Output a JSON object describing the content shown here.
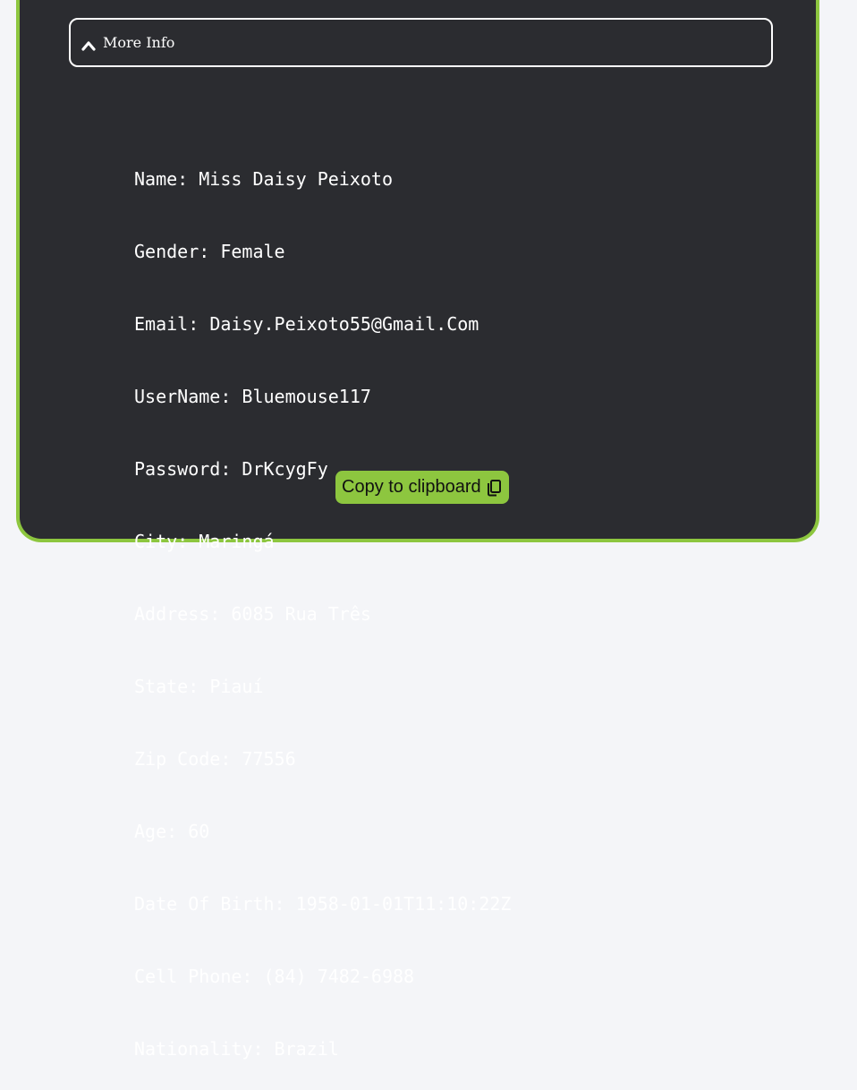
{
  "accordion": {
    "label": "More Info",
    "icon": "chevron-up-icon"
  },
  "details": [
    {
      "label": "Name",
      "value": "Miss Daisy Peixoto"
    },
    {
      "label": "Gender",
      "value": "Female"
    },
    {
      "label": "Email",
      "value": "Daisy.Peixoto55@Gmail.Com"
    },
    {
      "label": "UserName",
      "value": "Bluemouse117"
    },
    {
      "label": "Password",
      "value": "DrKcygFy"
    },
    {
      "label": "City",
      "value": "Maringá"
    },
    {
      "label": "Address",
      "value": "6085 Rua Três"
    },
    {
      "label": "State",
      "value": "Piauí"
    },
    {
      "label": "Zip Code",
      "value": "77556"
    },
    {
      "label": "Age",
      "value": "60"
    },
    {
      "label": "Date Of Birth",
      "value": "1958-01-01T11:10:22Z"
    },
    {
      "label": "Cell Phone",
      "value": "(84) 7482-6988"
    },
    {
      "label": "Nationality",
      "value": "Brazil"
    }
  ],
  "copy_button": {
    "label": "Copy to clipboard",
    "icon": "copy-icon"
  },
  "colors": {
    "accent": "#8dc63f",
    "card_background": "#2b2c30",
    "page_background": "#f4f5f8",
    "text": "#ffffff"
  }
}
